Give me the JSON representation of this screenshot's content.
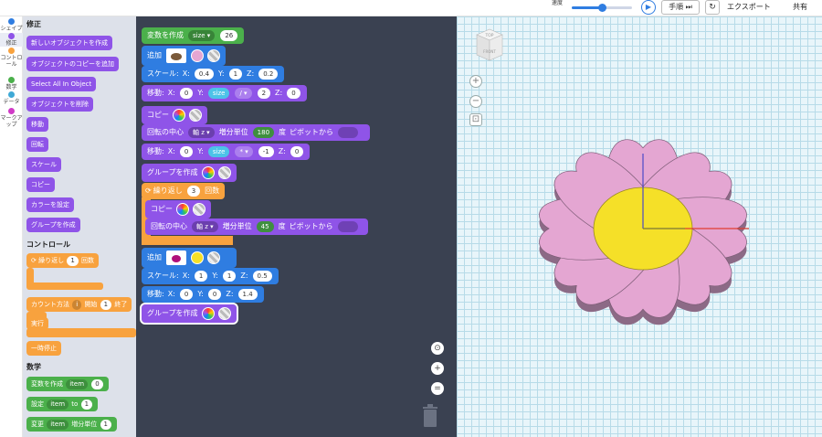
{
  "topbar": {
    "speed_label": "速度",
    "speed_value": 0.5,
    "play_icon": "play-icon",
    "step_label": "手順",
    "export_label": "エクスポート",
    "share_label": "共有"
  },
  "categories": [
    {
      "label": "シェイプ",
      "color": "#2f7de1"
    },
    {
      "label": "修正",
      "color": "#8f54e8"
    },
    {
      "label": "コントロール",
      "color": "#f8a23e"
    },
    {
      "label": "数学",
      "color": "#4bb04b"
    },
    {
      "label": "データ",
      "color": "#3fa9d6"
    },
    {
      "label": "マークアップ",
      "color": "#d03ac6"
    }
  ],
  "palette": {
    "section_modify": "修正",
    "modify_blocks": [
      "新しいオブジェクトを作成",
      "オブジェクトのコピーを追加",
      "Select All In Object",
      "オブジェクトを削除",
      "移動",
      "回転",
      "スケール",
      "コピー",
      "カラーを設定",
      "グループを作成"
    ],
    "section_control": "コントロール",
    "repeat_label": "繰り返し",
    "repeat_count": "1",
    "repeat_suffix": "回数",
    "count_label": "カウント方法",
    "count_var": "i",
    "count_from_label": "開始",
    "count_from": "1",
    "count_to_label": "終了",
    "run_label": "実行",
    "pause_label": "一時停止",
    "section_math": "数学",
    "create_var_label": "変数を作成",
    "create_var_name": "item",
    "create_var_value": "0",
    "set_label": "設定",
    "set_var": "item",
    "set_to": "to",
    "set_value": "1",
    "change_label": "変更",
    "change_var": "item",
    "change_by": "増分単位",
    "change_value": "1"
  },
  "workspace": {
    "create_var_label": "変数を作成",
    "var_name": "size",
    "var_value": "26",
    "add_label": "追加",
    "scale_label": "スケール:",
    "scale1": {
      "x": "0.4",
      "y": "1",
      "z": "0.2"
    },
    "move_label": "移動:",
    "move1": {
      "x": "0",
      "y_var": "size",
      "op": "/",
      "y_val": "2",
      "z": "0"
    },
    "copy_label": "コピー",
    "rotate_label": "回転の中心",
    "axis_label": "軸 z",
    "step_label": "増分単位",
    "rotate1_value": "180",
    "degree_label": "度",
    "pivot_label": "ピボットから",
    "move2": {
      "x": "0",
      "y_var": "size",
      "op": "*",
      "y_val": "-1",
      "z": "0"
    },
    "group_label": "グループを作成",
    "repeat_label": "繰り返し",
    "repeat_count": "3",
    "repeat_suffix": "回数",
    "rotate2_value": "45",
    "scale2": {
      "x": "1",
      "y": "1",
      "z": "0.5"
    },
    "move3": {
      "x": "0",
      "y": "0",
      "z": "1.4"
    }
  },
  "viewport": {
    "cube_top": "TOP",
    "cube_front": "FRONT",
    "petal_color": "#e4a6d2",
    "center_color": "#f5e028"
  },
  "colors": {
    "green": "#4bb04b",
    "blue": "#2f7de1",
    "purple": "#8f54e8",
    "orange": "#f8a23e",
    "workspace_bg": "#3a4151"
  }
}
